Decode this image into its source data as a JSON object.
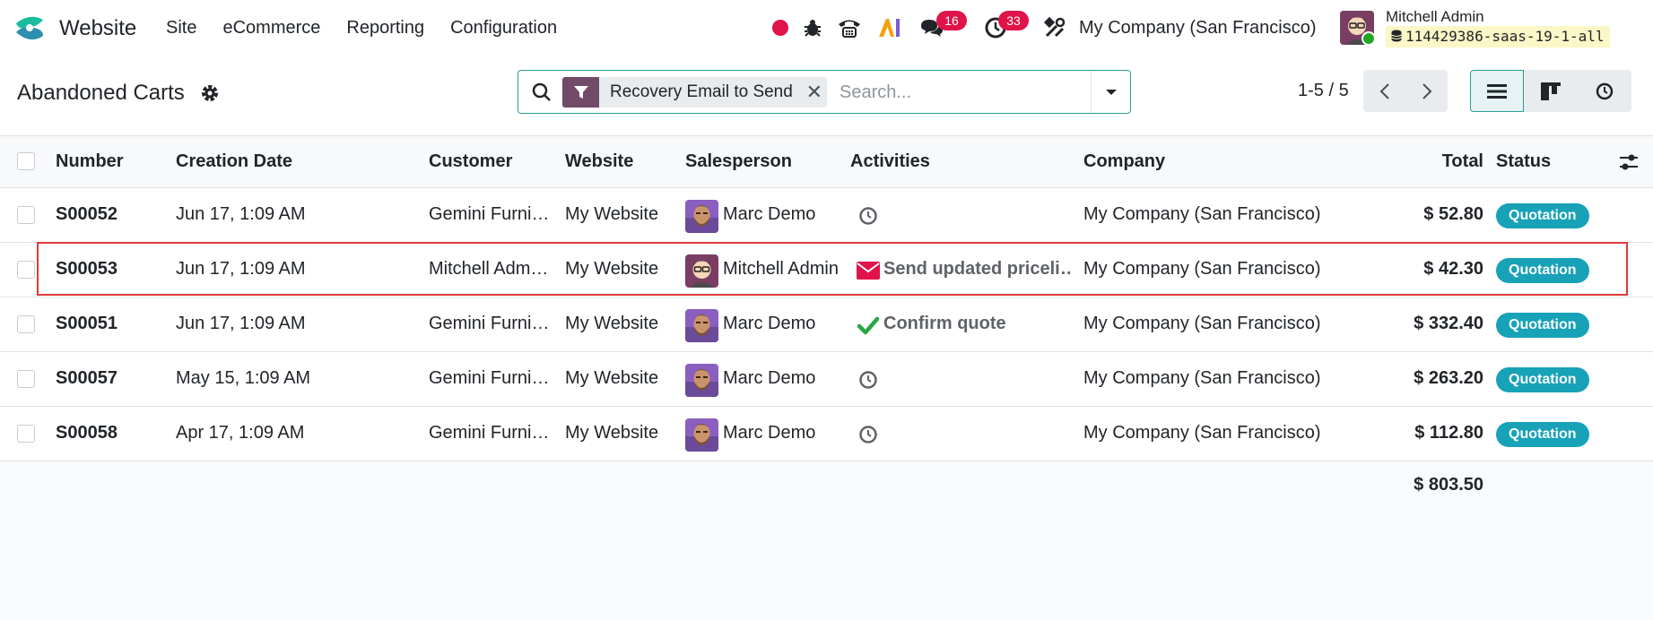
{
  "navbar": {
    "app_name": "Website",
    "menu": [
      "Site",
      "eCommerce",
      "Reporting",
      "Configuration"
    ],
    "messages_count": "16",
    "activities_count": "33",
    "company": "My Company (San Francisco)",
    "user_name": "Mitchell Admin",
    "database": "114429386-saas-19-1-all",
    "colors": {
      "badge": "#e0134a",
      "record_dot": "#e0134a",
      "brand": "#714b67"
    }
  },
  "control": {
    "title": "Abandoned Carts",
    "facet_label": "Recovery Email to Send",
    "search_placeholder": "Search...",
    "pager": "1-5 / 5"
  },
  "table": {
    "columns": [
      "Number",
      "Creation Date",
      "Customer",
      "Website",
      "Salesperson",
      "Activities",
      "Company",
      "Total",
      "Status"
    ],
    "rows": [
      {
        "number": "S00052",
        "date": "Jun 17, 1:09 AM",
        "customer": "Gemini Furni…",
        "website": "My Website",
        "salesperson": "Marc Demo",
        "avatar": "marc",
        "activity": "",
        "activity_icon": "clock-icon",
        "company": "My Company (San Francisco)",
        "total": "$ 52.80",
        "status": "Quotation"
      },
      {
        "number": "S00053",
        "date": "Jun 17, 1:09 AM",
        "customer": "Mitchell Adm…",
        "website": "My Website",
        "salesperson": "Mitchell Admin",
        "avatar": "mitchell",
        "activity": "Send updated priceli…",
        "activity_icon": "envelope-icon",
        "company": "My Company (San Francisco)",
        "total": "$ 42.30",
        "status": "Quotation"
      },
      {
        "number": "S00051",
        "date": "Jun 17, 1:09 AM",
        "customer": "Gemini Furni…",
        "website": "My Website",
        "salesperson": "Marc Demo",
        "avatar": "marc",
        "activity": "Confirm quote",
        "activity_icon": "check-icon",
        "company": "My Company (San Francisco)",
        "total": "$ 332.40",
        "status": "Quotation"
      },
      {
        "number": "S00057",
        "date": "May 15, 1:09 AM",
        "customer": "Gemini Furni…",
        "website": "My Website",
        "salesperson": "Marc Demo",
        "avatar": "marc",
        "activity": "",
        "activity_icon": "clock-icon",
        "company": "My Company (San Francisco)",
        "total": "$ 263.20",
        "status": "Quotation"
      },
      {
        "number": "S00058",
        "date": "Apr 17, 1:09 AM",
        "customer": "Gemini Furni…",
        "website": "My Website",
        "salesperson": "Marc Demo",
        "avatar": "marc",
        "activity": "",
        "activity_icon": "clock-icon",
        "company": "My Company (San Francisco)",
        "total": "$ 112.80",
        "status": "Quotation"
      }
    ],
    "grand_total": "$ 803.50",
    "colors": {
      "status": "#17a2b8",
      "email_activity": "#e0134a",
      "done_activity": "#28a745",
      "highlight": "#e03a3a"
    }
  }
}
